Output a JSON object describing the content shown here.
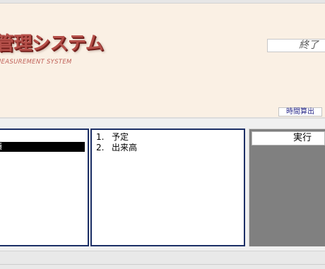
{
  "header": {
    "title": "管理システム",
    "subtitle": "MEASUREMENT  SYSTEM",
    "end_field_text": "終了",
    "time_calc_label": "時間算出"
  },
  "left_panel": {
    "selected_item": "積"
  },
  "middle_panel": {
    "items": [
      {
        "number": "1.",
        "label": "予定"
      },
      {
        "number": "2.",
        "label": "出来高"
      }
    ]
  },
  "right_panel": {
    "run_label": "実行"
  }
}
